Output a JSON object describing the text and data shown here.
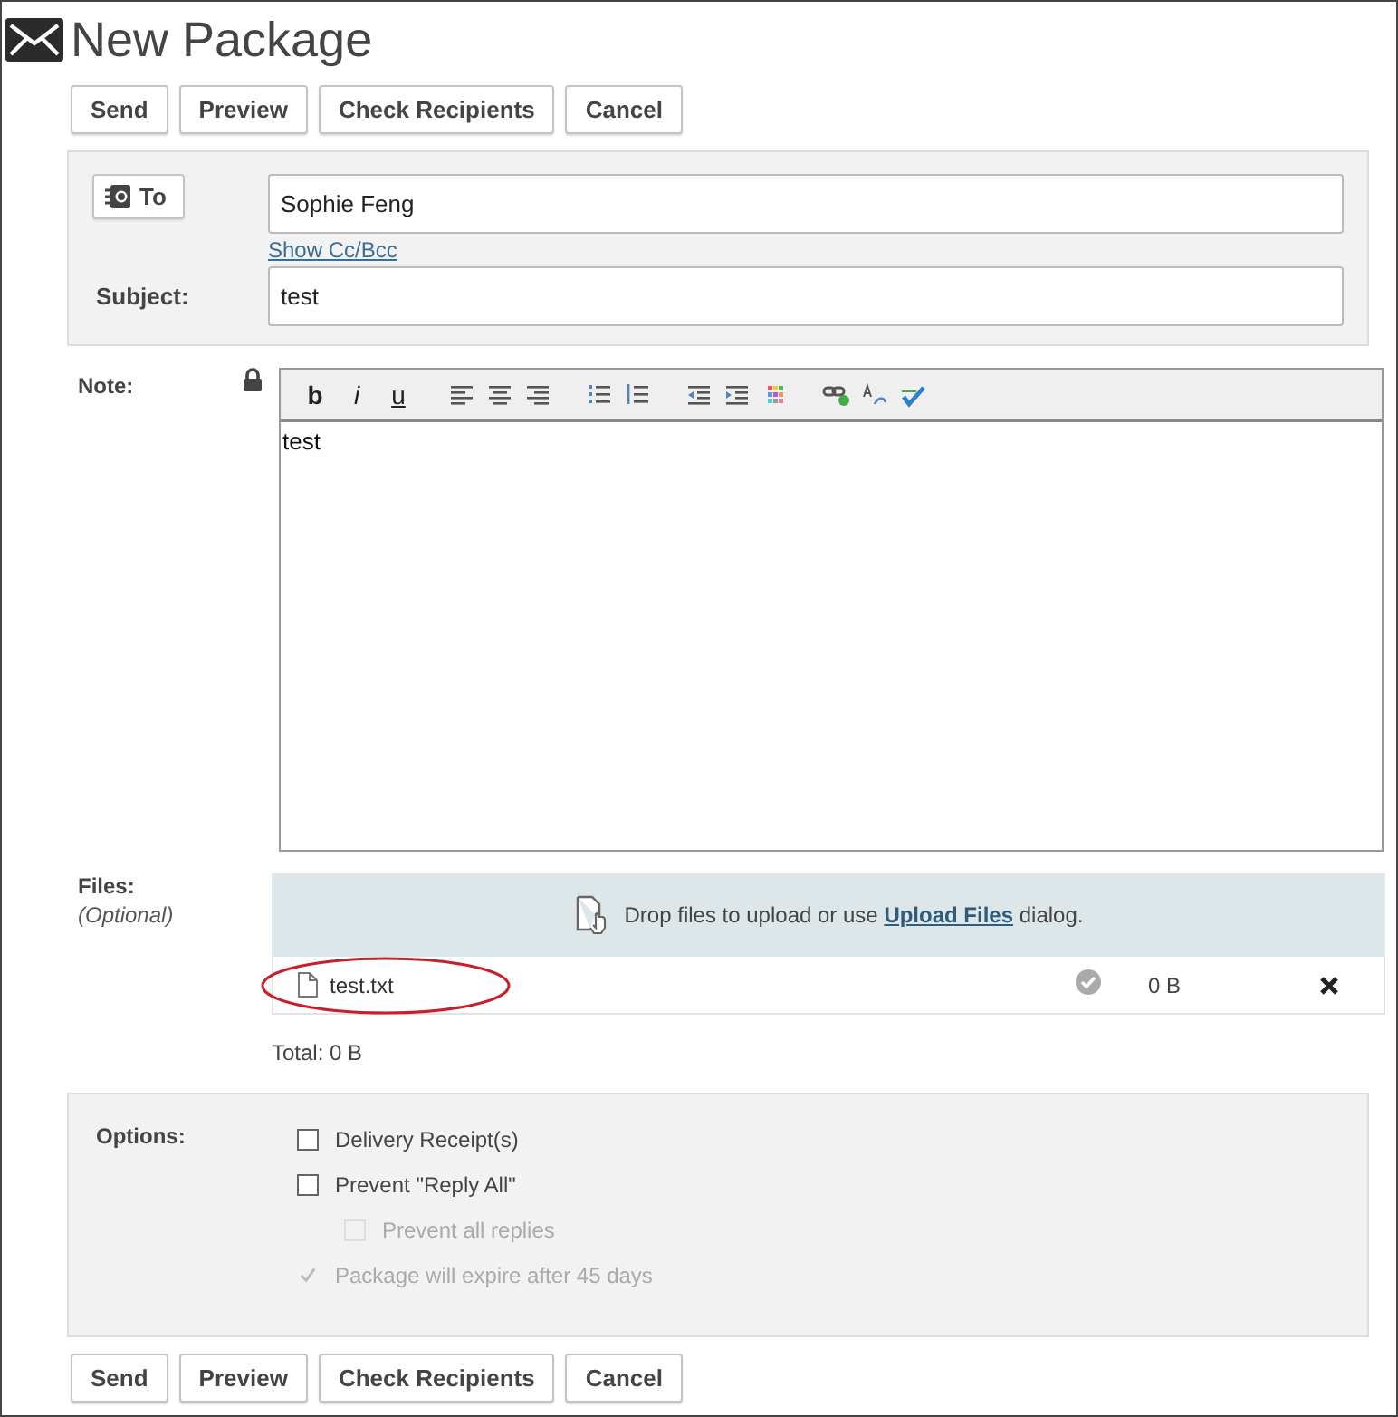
{
  "window": {
    "title": "New Package"
  },
  "top_buttons": [
    "Send",
    "Preview",
    "Check Recipients",
    "Cancel"
  ],
  "recipients": {
    "to_button": "To",
    "to_value": "Sophie Feng",
    "cc_link": "Show Cc/Bcc",
    "subject_label": "Subject:",
    "subject_value": "test"
  },
  "note": {
    "label": "Note:",
    "locked": true,
    "toolbar": [
      {
        "kind": "bold",
        "label": "b"
      },
      {
        "kind": "italic",
        "label": "i"
      },
      {
        "kind": "underline",
        "label": "u"
      },
      {
        "kind": "align-left"
      },
      {
        "kind": "align-center"
      },
      {
        "kind": "align-right"
      },
      {
        "kind": "bullets"
      },
      {
        "kind": "numbers"
      },
      {
        "kind": "outdent"
      },
      {
        "kind": "indent"
      },
      {
        "kind": "colors"
      },
      {
        "kind": "link"
      },
      {
        "kind": "spell"
      },
      {
        "kind": "check"
      }
    ],
    "body": "test"
  },
  "files": {
    "label": "Files:",
    "hint": "(Optional)",
    "drop_text": "Drop files to upload or use **Upload Files** dialog.",
    "items": [
      {
        "name": "test.txt",
        "uploaded": true,
        "size": "0 B",
        "circled": true
      }
    ],
    "total": "Total: 0 B"
  },
  "options": {
    "label": "Options:",
    "items": [
      {
        "label": "Delivery Receipt(s)",
        "checked": false,
        "disabled": false,
        "nested": false
      },
      {
        "label": "Prevent \"Reply All\"",
        "checked": false,
        "disabled": false,
        "nested": false
      },
      {
        "label": "Prevent all replies",
        "checked": false,
        "disabled": true,
        "nested": true
      },
      {
        "label": "Package will expire after 45 days",
        "checked": true,
        "disabled": true,
        "nested": false
      }
    ]
  },
  "bottom_buttons": [
    "Send",
    "Preview",
    "Check Recipients",
    "Cancel"
  ]
}
